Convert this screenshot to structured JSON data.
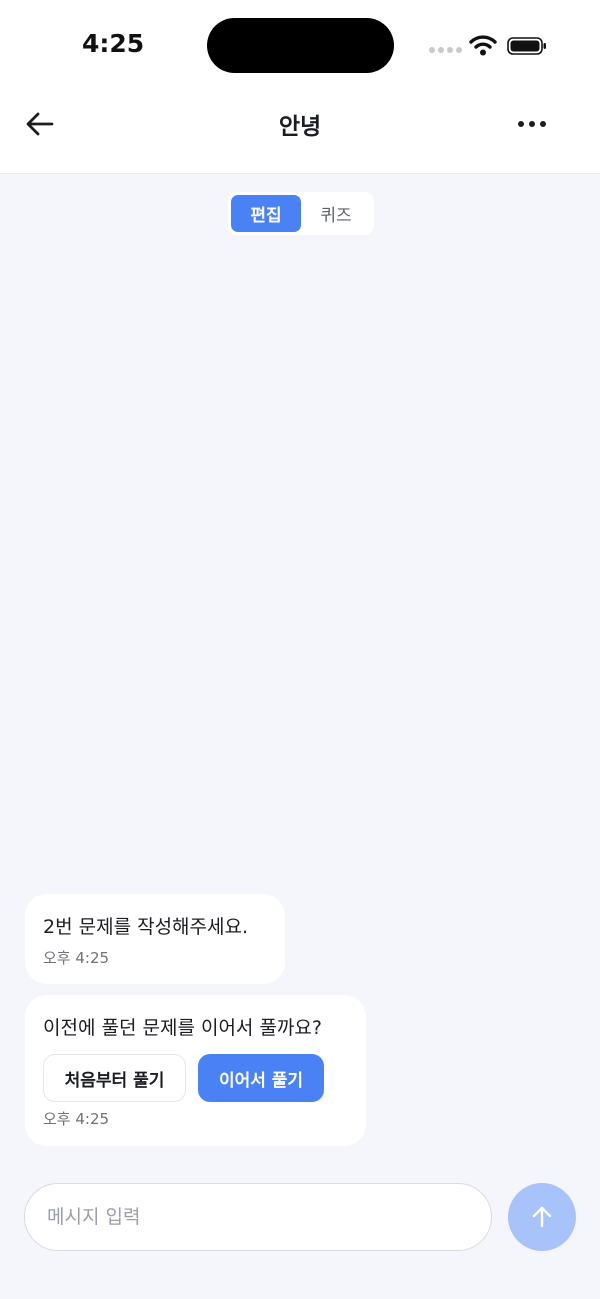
{
  "status_bar": {
    "time": "4:25"
  },
  "header": {
    "title": "안녕"
  },
  "tabs": [
    {
      "label": "편집",
      "active": true
    },
    {
      "label": "퀴즈",
      "active": false
    }
  ],
  "messages": [
    {
      "text": "2번 문제를 작성해주세요.",
      "time": "오후 4:25"
    },
    {
      "text": "이전에 풀던 문제를 이어서 풀까요?",
      "time": "오후 4:25",
      "choices": [
        {
          "label": "처음부터 풀기",
          "style": "secondary"
        },
        {
          "label": "이어서 풀기",
          "style": "primary"
        }
      ]
    }
  ],
  "composer": {
    "placeholder": "메시지 입력",
    "value": ""
  },
  "colors": {
    "accent": "#4a82f5",
    "send_disabled": "#a8c2fa",
    "background": "#f4f6fb"
  },
  "icons": {
    "back": "arrow-left-icon",
    "more": "more-dots-icon",
    "send": "arrow-up-icon"
  }
}
